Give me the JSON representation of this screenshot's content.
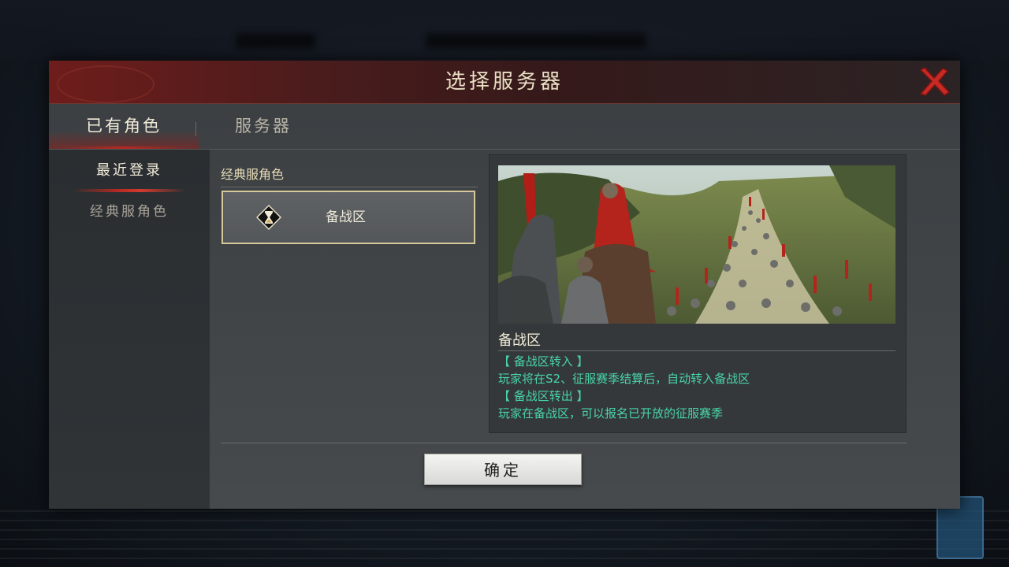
{
  "dialog": {
    "title": "选择服务器",
    "close_icon": "close-x-icon"
  },
  "tabs": [
    {
      "label": "已有角色",
      "active": true
    },
    {
      "label": "服务器",
      "active": false
    }
  ],
  "sidebar": {
    "items": [
      {
        "label": "最近登录",
        "active": true
      },
      {
        "label": "经典服角色",
        "active": false
      }
    ]
  },
  "list": {
    "header": "经典服角色",
    "servers": [
      {
        "name": "备战区",
        "icon": "hourglass-icon",
        "selected": true
      }
    ]
  },
  "preview": {
    "title": "备战区",
    "lines": [
      "【 备战区转入 】",
      "玩家将在S2、征服赛季结算后，自动转入备战区",
      "【 备战区转出 】",
      "玩家在备战区，可以报名已开放的征服赛季"
    ]
  },
  "confirm_label": "确定",
  "colors": {
    "accent_red": "#b42a22",
    "desc_green": "#49d4a6",
    "title_gold": "#eadfc4",
    "card_border": "#d6c89a"
  }
}
